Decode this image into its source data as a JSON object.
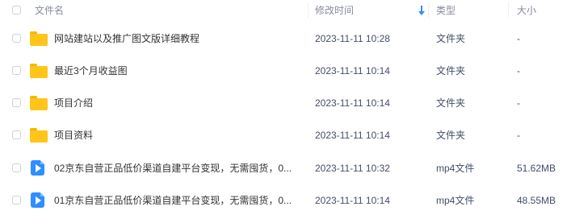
{
  "header": {
    "name_label": "文件名",
    "mtime_label": "修改时间",
    "type_label": "类型",
    "size_label": "大小",
    "sort_icon": "arrow-down-icon",
    "accent_color": "#2e8fff"
  },
  "rows": [
    {
      "icon": "folder-icon",
      "name": "网站建站以及推广图文版详细教程",
      "mtime": "2023-11-11 10:28",
      "type": "文件夹",
      "size": "-"
    },
    {
      "icon": "folder-icon",
      "name": "最近3个月收益图",
      "mtime": "2023-11-11 10:14",
      "type": "文件夹",
      "size": "-"
    },
    {
      "icon": "folder-icon",
      "name": "项目介绍",
      "mtime": "2023-11-11 10:14",
      "type": "文件夹",
      "size": "-"
    },
    {
      "icon": "folder-icon",
      "name": "项目资料",
      "mtime": "2023-11-11 10:14",
      "type": "文件夹",
      "size": "-"
    },
    {
      "icon": "video-icon",
      "name": "02京东自营正品低价渠道自建平台变现，无需囤货，0...",
      "mtime": "2023-11-11 10:32",
      "type": "mp4文件",
      "size": "51.62MB"
    },
    {
      "icon": "video-icon",
      "name": "01京东自营正品低价渠道自建平台变现，无需囤货，0...",
      "mtime": "2023-11-11 10:14",
      "type": "mp4文件",
      "size": "48.55MB"
    }
  ]
}
